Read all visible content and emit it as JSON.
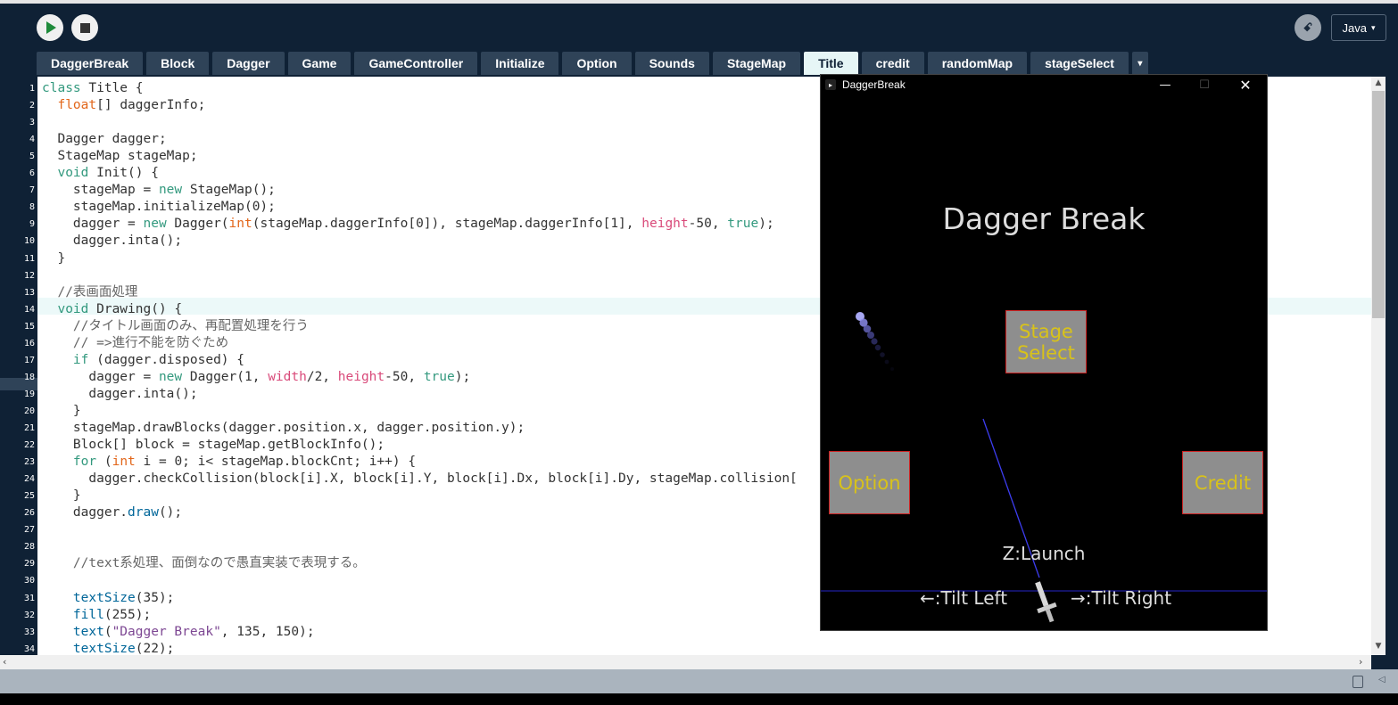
{
  "toolbar": {
    "run_icon": "play-icon",
    "stop_icon": "stop-icon",
    "debug_icon": "butterfly-icon",
    "debug_glyph": "ꗃ",
    "mode": "Java",
    "mode_caret": "▾"
  },
  "tabs": [
    {
      "label": "DaggerBreak"
    },
    {
      "label": "Block"
    },
    {
      "label": "Dagger"
    },
    {
      "label": "Game"
    },
    {
      "label": "GameController"
    },
    {
      "label": "Initialize"
    },
    {
      "label": "Option"
    },
    {
      "label": "Sounds"
    },
    {
      "label": "StageMap"
    },
    {
      "label": "Title",
      "active": true
    },
    {
      "label": "credit"
    },
    {
      "label": "randomMap"
    },
    {
      "label": "stageSelect"
    }
  ],
  "tab_menu_glyph": "▾",
  "editor": {
    "current_line": 14,
    "line_numbers": [
      "1",
      "2",
      "3",
      "4",
      "5",
      "6",
      "7",
      "8",
      "9",
      "10",
      "11",
      "12",
      "13",
      "14",
      "15",
      "16",
      "17",
      "18",
      "19",
      "20",
      "21",
      "22",
      "23",
      "24",
      "25",
      "26",
      "27",
      "28",
      "29",
      "30",
      "31",
      "32",
      "33",
      "34"
    ],
    "lines": [
      "class Title {",
      "  float[] daggerInfo;",
      "",
      "  Dagger dagger;",
      "  StageMap stageMap;",
      "  void Init() {",
      "    stageMap = new StageMap();",
      "    stageMap.initializeMap(0);",
      "    dagger = new Dagger(int(stageMap.daggerInfo[0]), stageMap.daggerInfo[1], height-50, true);",
      "    dagger.inta();",
      "  }",
      "",
      "  //表画面処理",
      "  void Drawing() {",
      "    //タイトル画面のみ、再配置処理を行う",
      "    // =>進行不能を防ぐため",
      "    if (dagger.disposed) {",
      "      dagger = new Dagger(1, width/2, height-50, true);",
      "      dagger.inta();",
      "    }",
      "    stageMap.drawBlocks(dagger.position.x, dagger.position.y);",
      "    Block[] block = stageMap.getBlockInfo();",
      "    for (int i = 0; i< stageMap.blockCnt; i++) {",
      "      dagger.checkCollision(block[i].X, block[i].Y, block[i].Dx, block[i].Dy, stageMap.collision[",
      "    }",
      "    dagger.draw();",
      "",
      "",
      "    //text系処理、面倒なので愚直実装で表現する。",
      "",
      "    textSize(35);",
      "    fill(255);",
      "    text(\"Dagger Break\", 135, 150);",
      "    textSize(22);"
    ]
  },
  "sketch": {
    "window_title": "DaggerBreak",
    "app_glyph": "▸",
    "minimize_glyph": "—",
    "maximize_glyph": "☐",
    "close_glyph": "✕",
    "game_title": "Dagger Break",
    "stage_select": "Stage Select",
    "option": "Option",
    "credit": "Credit",
    "launch_hint": "Z:Launch",
    "tilt_left": "←:Tilt Left",
    "tilt_right": "→:Tilt Right",
    "button_fill": "#8e8e8e",
    "button_border": "#cc2222",
    "button_text": "#d8c21a"
  },
  "colors": {
    "chrome": "#0f2135",
    "tab": "#2f4358",
    "tab_active": "#e6f6f6",
    "keyword": "#33997e",
    "type": "#e2661a",
    "function": "#006699",
    "comment": "#666666",
    "builtin_var": "#d94a7a",
    "string": "#7d4793"
  }
}
